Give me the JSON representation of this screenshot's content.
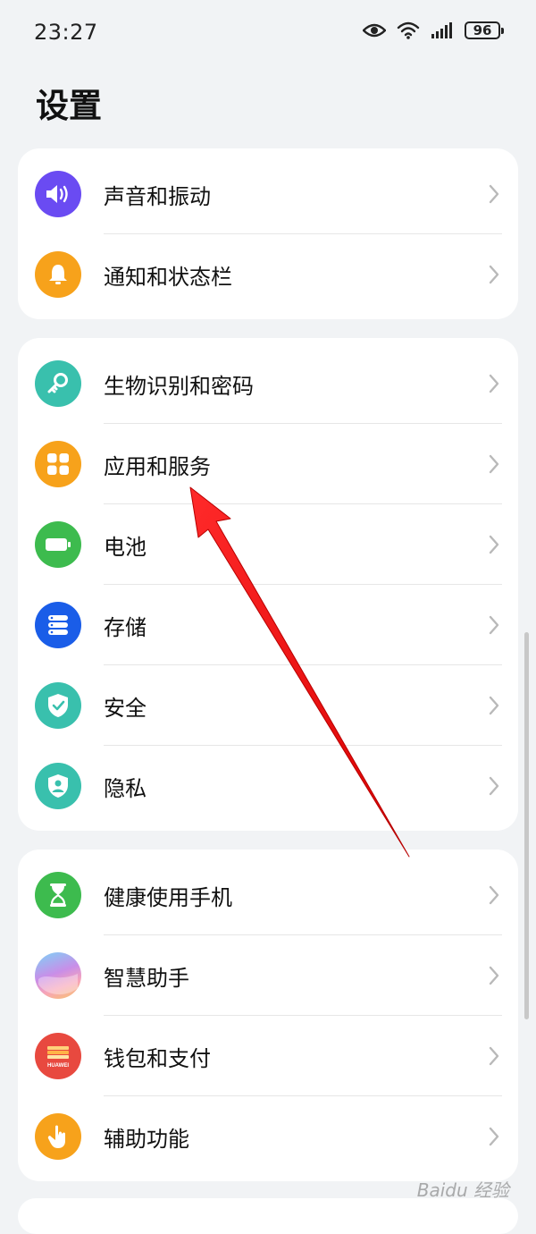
{
  "status": {
    "time": "23:27",
    "battery": "96"
  },
  "title": "设置",
  "groups": [
    {
      "items": [
        {
          "label": "声音和振动",
          "icon": "speaker-icon",
          "color": "#6a4bf2"
        },
        {
          "label": "通知和状态栏",
          "icon": "bell-icon",
          "color": "#f7a21b"
        }
      ]
    },
    {
      "items": [
        {
          "label": "生物识别和密码",
          "icon": "key-icon",
          "color": "#39c0ad"
        },
        {
          "label": "应用和服务",
          "icon": "apps-grid-icon",
          "color": "#f7a21b"
        },
        {
          "label": "电池",
          "icon": "battery-icon",
          "color": "#3dbb4e"
        },
        {
          "label": "存储",
          "icon": "storage-icon",
          "color": "#1a5de8"
        },
        {
          "label": "安全",
          "icon": "shield-check-icon",
          "color": "#39c0ad"
        },
        {
          "label": "隐私",
          "icon": "privacy-shield-icon",
          "color": "#39c0ad"
        }
      ]
    },
    {
      "items": [
        {
          "label": "健康使用手机",
          "icon": "hourglass-icon",
          "color": "#3dbb4e"
        },
        {
          "label": "智慧助手",
          "icon": "assistant-orb-icon",
          "color": "#c98ee8"
        },
        {
          "label": "钱包和支付",
          "icon": "wallet-icon",
          "color": "#e8493f"
        },
        {
          "label": "辅助功能",
          "icon": "hand-tap-icon",
          "color": "#f7a21b"
        }
      ]
    }
  ],
  "wallet_brand": "HUAWEI",
  "watermark": "Baidu 经验"
}
